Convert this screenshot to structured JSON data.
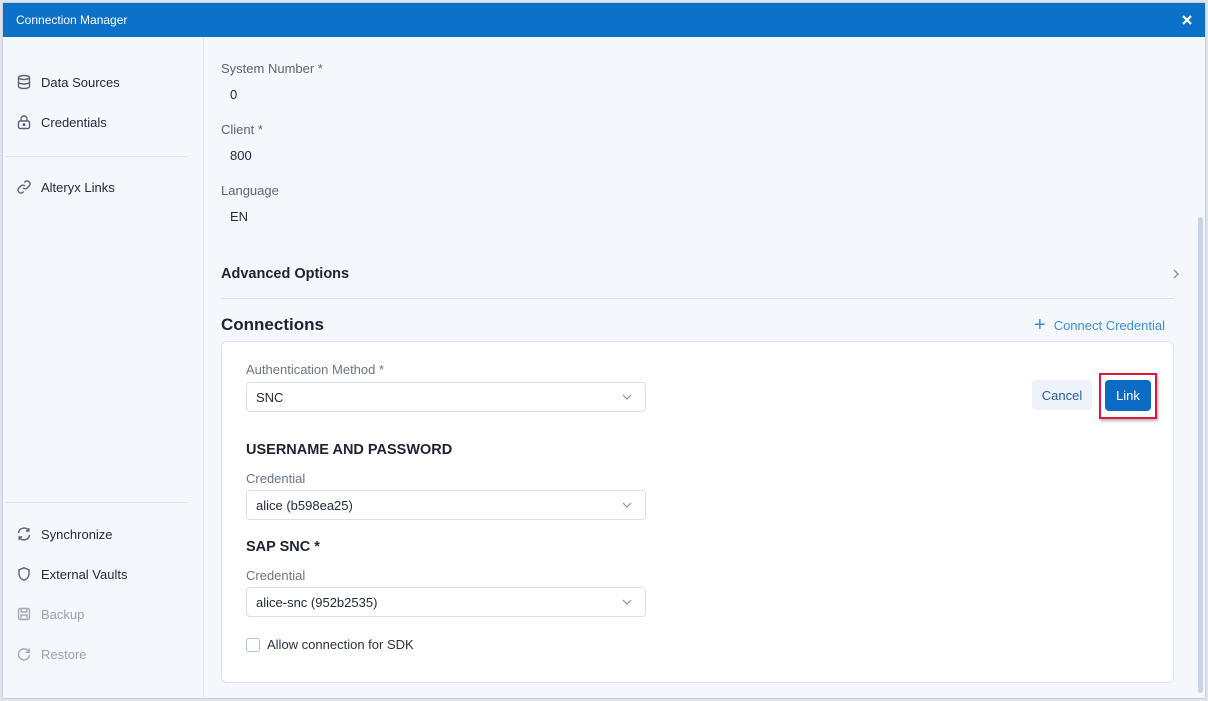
{
  "window": {
    "title": "Connection Manager",
    "close_icon": "close-icon"
  },
  "sidebar": {
    "items": [
      {
        "label": "Data Sources",
        "icon": "database-icon",
        "enabled": true
      },
      {
        "label": "Credentials",
        "icon": "lock-icon",
        "enabled": true
      },
      {
        "label": "Alteryx Links",
        "icon": "link-icon",
        "enabled": true
      },
      {
        "label": "Synchronize",
        "icon": "sync-icon",
        "enabled": true
      },
      {
        "label": "External Vaults",
        "icon": "shield-icon",
        "enabled": true
      },
      {
        "label": "Backup",
        "icon": "save-icon",
        "enabled": false
      },
      {
        "label": "Restore",
        "icon": "restore-icon",
        "enabled": false
      }
    ]
  },
  "main": {
    "fields": [
      {
        "label": "System Number *",
        "value": "0"
      },
      {
        "label": "Client *",
        "value": "800"
      },
      {
        "label": "Language",
        "value": "EN"
      }
    ],
    "advanced_options": {
      "label": "Advanced Options",
      "icon": "chevron-right-icon"
    },
    "connections": {
      "title": "Connections",
      "connect_credential_label": "Connect Credential",
      "auth_method": {
        "label": "Authentication Method *",
        "value": "SNC"
      },
      "cancel_label": "Cancel",
      "link_label": "Link",
      "username_password": {
        "heading": "USERNAME AND PASSWORD",
        "credential_label": "Credential",
        "credential_value": "alice (b598ea25)"
      },
      "sap_snc": {
        "heading": "SAP SNC *",
        "credential_label": "Credential",
        "credential_value": "alice-snc (952b2535)"
      },
      "sdk_checkbox": {
        "label": "Allow connection for SDK",
        "checked": false
      }
    }
  },
  "colors": {
    "titlebar": "#0c71c8",
    "accent": "#0c6bc5",
    "highlight": "#e2143e"
  }
}
